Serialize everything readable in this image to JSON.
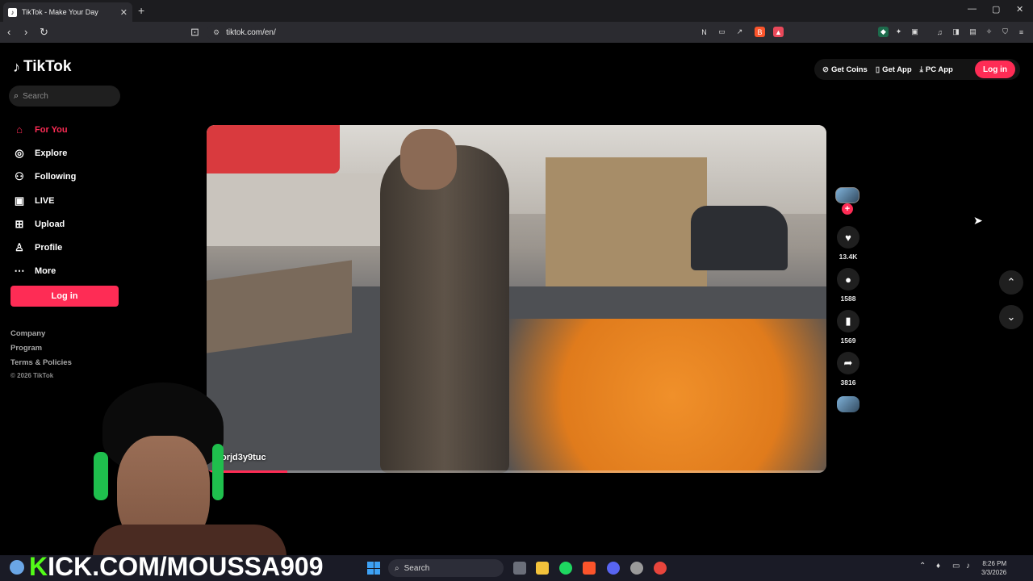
{
  "browser": {
    "tab_title": "TikTok - Make Your Day",
    "tab_close": "✕",
    "new_tab": "+",
    "url": "tiktok.com/en/",
    "win_min": "—",
    "win_max": "▢",
    "win_close": "✕"
  },
  "sidebar": {
    "logo_text": "TikTok",
    "search_placeholder": "Search",
    "items": [
      {
        "label": "For You",
        "icon": "home-icon"
      },
      {
        "label": "Explore",
        "icon": "compass-icon"
      },
      {
        "label": "Following",
        "icon": "following-icon"
      },
      {
        "label": "LIVE",
        "icon": "live-icon"
      },
      {
        "label": "Upload",
        "icon": "upload-icon"
      },
      {
        "label": "Profile",
        "icon": "profile-icon"
      },
      {
        "label": "More",
        "icon": "more-icon"
      }
    ],
    "login_label": "Log in",
    "footer": [
      "Company",
      "Program",
      "Terms & Policies"
    ],
    "copyright": "© 2026 TikTok"
  },
  "header": {
    "get_coins": "Get Coins",
    "get_app": "Get App",
    "pc_app": "PC App",
    "login_label": "Log in"
  },
  "video": {
    "username": "orjd3y9tuc",
    "progress": 0.13
  },
  "actions": {
    "likes": "13.4K",
    "comments": "1588",
    "saves": "1569",
    "shares": "3816"
  },
  "overlay": {
    "kick_prefix": "K",
    "kick_rest": "ICK.COM/MOUSSA909"
  },
  "taskbar": {
    "search_label": "Search",
    "time": "8:26 PM",
    "date": "3/3/2026"
  },
  "colors": {
    "accent": "#fe2c55",
    "kick_green": "#53fc18"
  }
}
